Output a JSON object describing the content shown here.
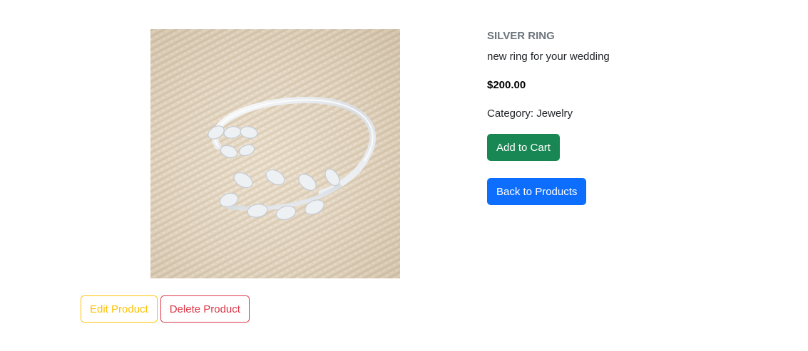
{
  "product": {
    "name": "SILVER RING",
    "description": "new ring for your wedding",
    "price": "$200.00",
    "category_label": "Category: Jewelry"
  },
  "actions": {
    "add_to_cart": "Add to Cart",
    "back_to_products": "Back to Products",
    "edit_product": "Edit Product",
    "delete_product": "Delete Product"
  },
  "colors": {
    "success": "#198754",
    "primary": "#0d6efd",
    "warning": "#ffc107",
    "danger": "#dc3545",
    "muted": "#6c757d"
  }
}
